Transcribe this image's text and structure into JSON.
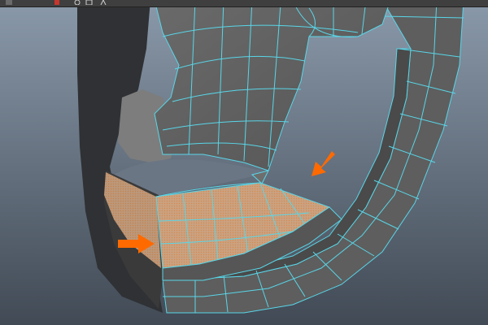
{
  "app": {
    "viewport_label": "",
    "background_top": "#8695a6",
    "background_bottom": "#4a5563"
  },
  "toolbar": {
    "icons": [
      "snap-icon",
      "marker-icon",
      "camera-icon",
      "panel-icon",
      "select-tool-icon"
    ]
  },
  "colors": {
    "mesh_face": "#5c5c5c",
    "mesh_face_light": "#6e6e6e",
    "mesh_shadow": "#2e2e2e",
    "wireframe": "#59d6e8",
    "selected_faces": "#c8a27c",
    "arrow": "#ff6a00"
  },
  "annotations": {
    "arrows": [
      "arrow-pointing-at-lower-lip-faces",
      "arrow-pointing-at-jaw-faces"
    ]
  }
}
